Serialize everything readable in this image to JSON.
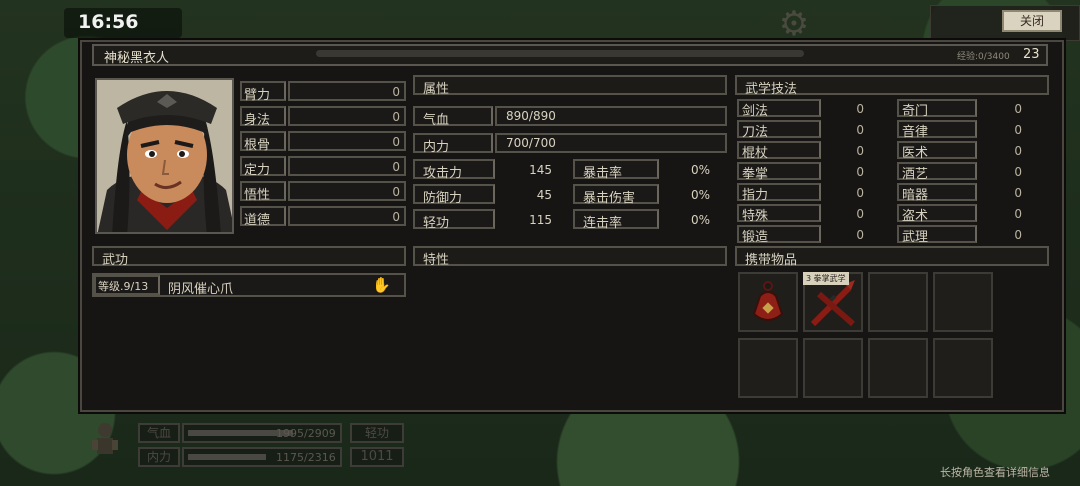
{
  "status": {
    "time": "16:56"
  },
  "header": {
    "close_label": "关闭",
    "name": "神秘黑衣人",
    "exp_text": "经验:0/3400",
    "level": "23",
    "exp_fill": 0.0
  },
  "base_stats": [
    {
      "label": "臂力",
      "value": "0"
    },
    {
      "label": "身法",
      "value": "0"
    },
    {
      "label": "根骨",
      "value": "0"
    },
    {
      "label": "定力",
      "value": "0"
    },
    {
      "label": "悟性",
      "value": "0"
    },
    {
      "label": "道德",
      "value": "0"
    }
  ],
  "attributes": {
    "title": "属性",
    "hp_label": "气血",
    "hp_value": "890/890",
    "mp_label": "内力",
    "mp_value": "700/700",
    "rows": [
      {
        "label": "攻击力",
        "value": "145",
        "label2": "暴击率",
        "value2": "0%"
      },
      {
        "label": "防御力",
        "value": "45",
        "label2": "暴击伤害",
        "value2": "0%"
      },
      {
        "label": "轻功",
        "value": "115",
        "label2": "连击率",
        "value2": "0%"
      }
    ]
  },
  "skills": {
    "title": "武学技法",
    "left": [
      {
        "label": "剑法",
        "value": "0"
      },
      {
        "label": "刀法",
        "value": "0"
      },
      {
        "label": "棍杖",
        "value": "0"
      },
      {
        "label": "拳掌",
        "value": "0"
      },
      {
        "label": "指力",
        "value": "0"
      },
      {
        "label": "特殊",
        "value": "0"
      },
      {
        "label": "锻造",
        "value": "0"
      }
    ],
    "right": [
      {
        "label": "奇门",
        "value": "0"
      },
      {
        "label": "音律",
        "value": "0"
      },
      {
        "label": "医术",
        "value": "0"
      },
      {
        "label": "酒艺",
        "value": "0"
      },
      {
        "label": "暗器",
        "value": "0"
      },
      {
        "label": "盗术",
        "value": "0"
      },
      {
        "label": "武理",
        "value": "0"
      }
    ]
  },
  "martial": {
    "title": "武功",
    "level_text": "等级.9/13",
    "name": "阴风催心爪"
  },
  "traits": {
    "title": "特性"
  },
  "items": {
    "title": "携带物品",
    "tag": "3 拳掌武学"
  },
  "hud": {
    "hp_label": "气血",
    "hp_value": "1995/2909",
    "hp_fill": 0.69,
    "mp_label": "内力",
    "mp_value": "1175/2316",
    "mp_fill": 0.51,
    "qinggong_label": "轻功",
    "qinggong_value": "1011"
  },
  "hint": "长按角色查看详细信息",
  "colors": {
    "panel_bg": "#161513",
    "frame": "#55524a",
    "text": "#d8d2c0",
    "accent_red": "#8a1c14"
  }
}
